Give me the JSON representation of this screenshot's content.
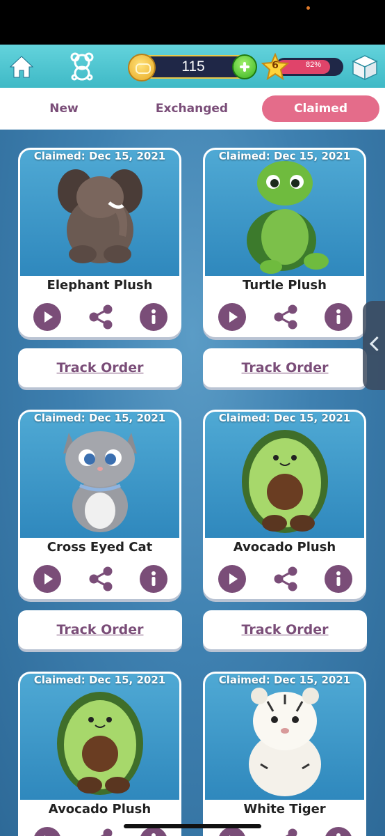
{
  "header": {
    "coins": "115",
    "level": "6",
    "level_progress_label": "82%",
    "level_progress": 0.82,
    "icons": [
      "home-icon",
      "teddy-bear-icon",
      "coin-icon",
      "plus-icon",
      "star-icon",
      "gift-box-icon"
    ]
  },
  "tabs": [
    {
      "label": "New",
      "active": false
    },
    {
      "label": "Exchanged",
      "active": false
    },
    {
      "label": "Claimed",
      "active": true
    }
  ],
  "track_label": "Track Order",
  "items": [
    {
      "date": "Claimed: Dec 15, 2021",
      "title": "Elephant Plush"
    },
    {
      "date": "Claimed: Dec 15, 2021",
      "title": "Turtle Plush"
    },
    {
      "date": "Claimed: Dec 15, 2021",
      "title": "Cross Eyed Cat"
    },
    {
      "date": "Claimed: Dec 15, 2021",
      "title": "Avocado Plush"
    },
    {
      "date": "Claimed: Dec 15, 2021",
      "title": "Avocado Plush"
    },
    {
      "date": "Claimed: Dec 15, 2021",
      "title": "White Tiger"
    }
  ],
  "colors": {
    "accent": "#7a4d78",
    "claimed_tab": "#e46c8a",
    "top_bar": "#4fc5d0"
  }
}
